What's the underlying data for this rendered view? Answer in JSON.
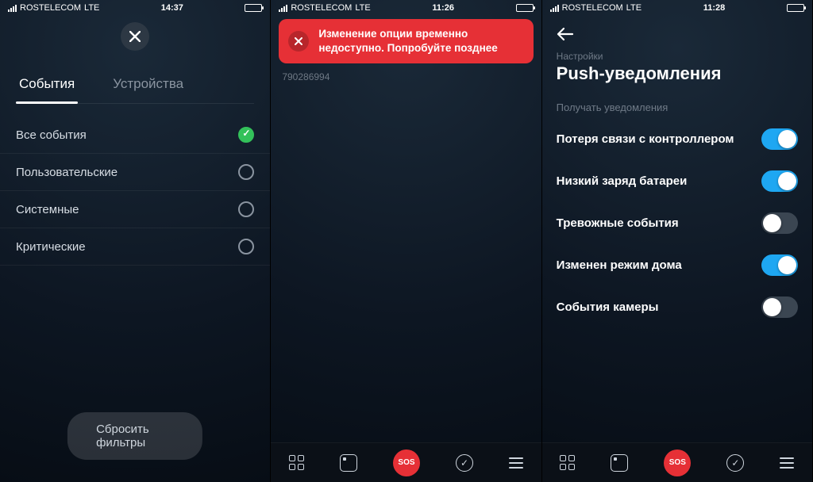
{
  "screens": [
    {
      "statusbar": {
        "carrier": "ROSTELECOM",
        "net": "LTE",
        "time": "14:37"
      },
      "tabs": {
        "events": "События",
        "devices": "Устройства"
      },
      "filters": [
        {
          "label": "Все события",
          "checked": true
        },
        {
          "label": "Пользовательские",
          "checked": false
        },
        {
          "label": "Системные",
          "checked": false
        },
        {
          "label": "Критические",
          "checked": false
        }
      ],
      "reset": "Сбросить фильтры"
    },
    {
      "statusbar": {
        "carrier": "ROSTELECOM",
        "net": "LTE",
        "time": "11:26"
      },
      "error": "Изменение опции временно недоступно. Попробуйте позднее",
      "id": "790286994",
      "nav": {
        "sos": "SOS"
      }
    },
    {
      "statusbar": {
        "carrier": "ROSTELECOM",
        "net": "LTE",
        "time": "11:28"
      },
      "crumb": "Настройки",
      "title": "Push-уведомления",
      "section": "Получать уведомления",
      "toggles": [
        {
          "label": "Потеря связи с контроллером",
          "on": true
        },
        {
          "label": "Низкий заряд батареи",
          "on": true
        },
        {
          "label": "Тревожные события",
          "on": false
        },
        {
          "label": "Изменен режим дома",
          "on": true
        },
        {
          "label": "События камеры",
          "on": false
        }
      ],
      "nav": {
        "sos": "SOS"
      }
    }
  ]
}
